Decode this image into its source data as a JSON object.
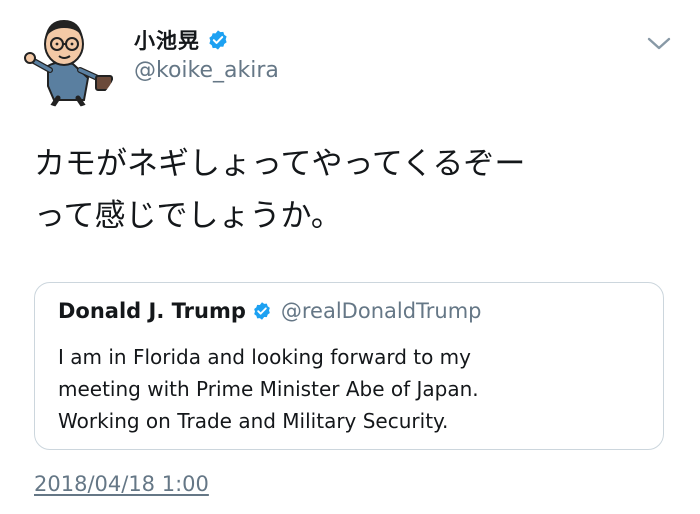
{
  "author": {
    "display_name": "小池晃",
    "screen_name": "@koike_akira",
    "verified": true
  },
  "tweet": {
    "text_lines": [
      "カモがネギしょってやってくるぞー",
      "って感じでしょうか。"
    ],
    "timestamp": "2018/04/18 1:00"
  },
  "quoted_tweet": {
    "display_name": "Donald J. Trump",
    "screen_name": "@realDonaldTrump",
    "verified": true,
    "text_lines": [
      "I am in Florida and looking forward to my",
      "meeting with Prime Minister Abe of Japan.",
      "Working on Trade and Military Security."
    ]
  },
  "icons": {
    "verified": "verified-badge-icon",
    "caret": "chevron-down-icon"
  },
  "colors": {
    "text_primary": "#14171a",
    "text_secondary": "#657786",
    "verified_blue": "#1da1f2",
    "border": "#ccd6dd"
  }
}
